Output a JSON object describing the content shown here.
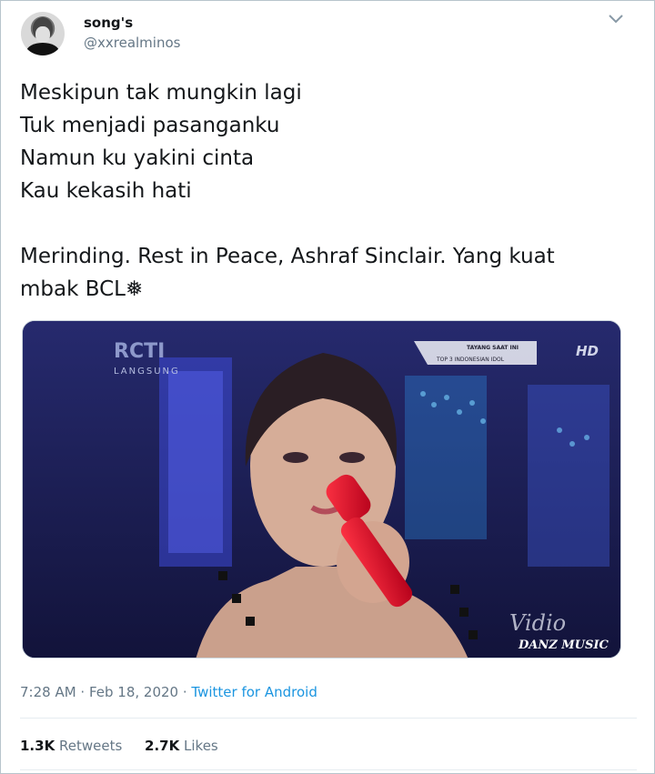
{
  "tweet": {
    "author": {
      "display_name": "song's",
      "handle": "@xxrealminos"
    },
    "text_lines": [
      "Meskipun tak mungkin lagi",
      "Tuk menjadi pasanganku",
      "Namun ku yakini cinta",
      "Kau kekasih hati"
    ],
    "text_lines_2": [
      "Merinding. Rest in Peace, Ashraf Sinclair. Yang kuat",
      "mbak BCL❅"
    ],
    "media": {
      "channel_logo": "RCTI",
      "live_label": "LANGSUNG",
      "hd_badge": "HD",
      "banner_top": "TAYANG SAAT INI",
      "banner_bottom": "TOP 3 INDONESIAN IDOL",
      "watermark_1": "Vidio",
      "watermark_2": "DANZ MUSIC"
    },
    "meta": {
      "time": "7:28 AM",
      "separator": " · ",
      "date": "Feb 18, 2020",
      "source": "Twitter for Android"
    },
    "stats": {
      "retweets_count": "1.3K",
      "retweets_label": "Retweets",
      "likes_count": "2.7K",
      "likes_label": "Likes"
    }
  },
  "icons": {
    "more": "chevron-down-icon"
  }
}
